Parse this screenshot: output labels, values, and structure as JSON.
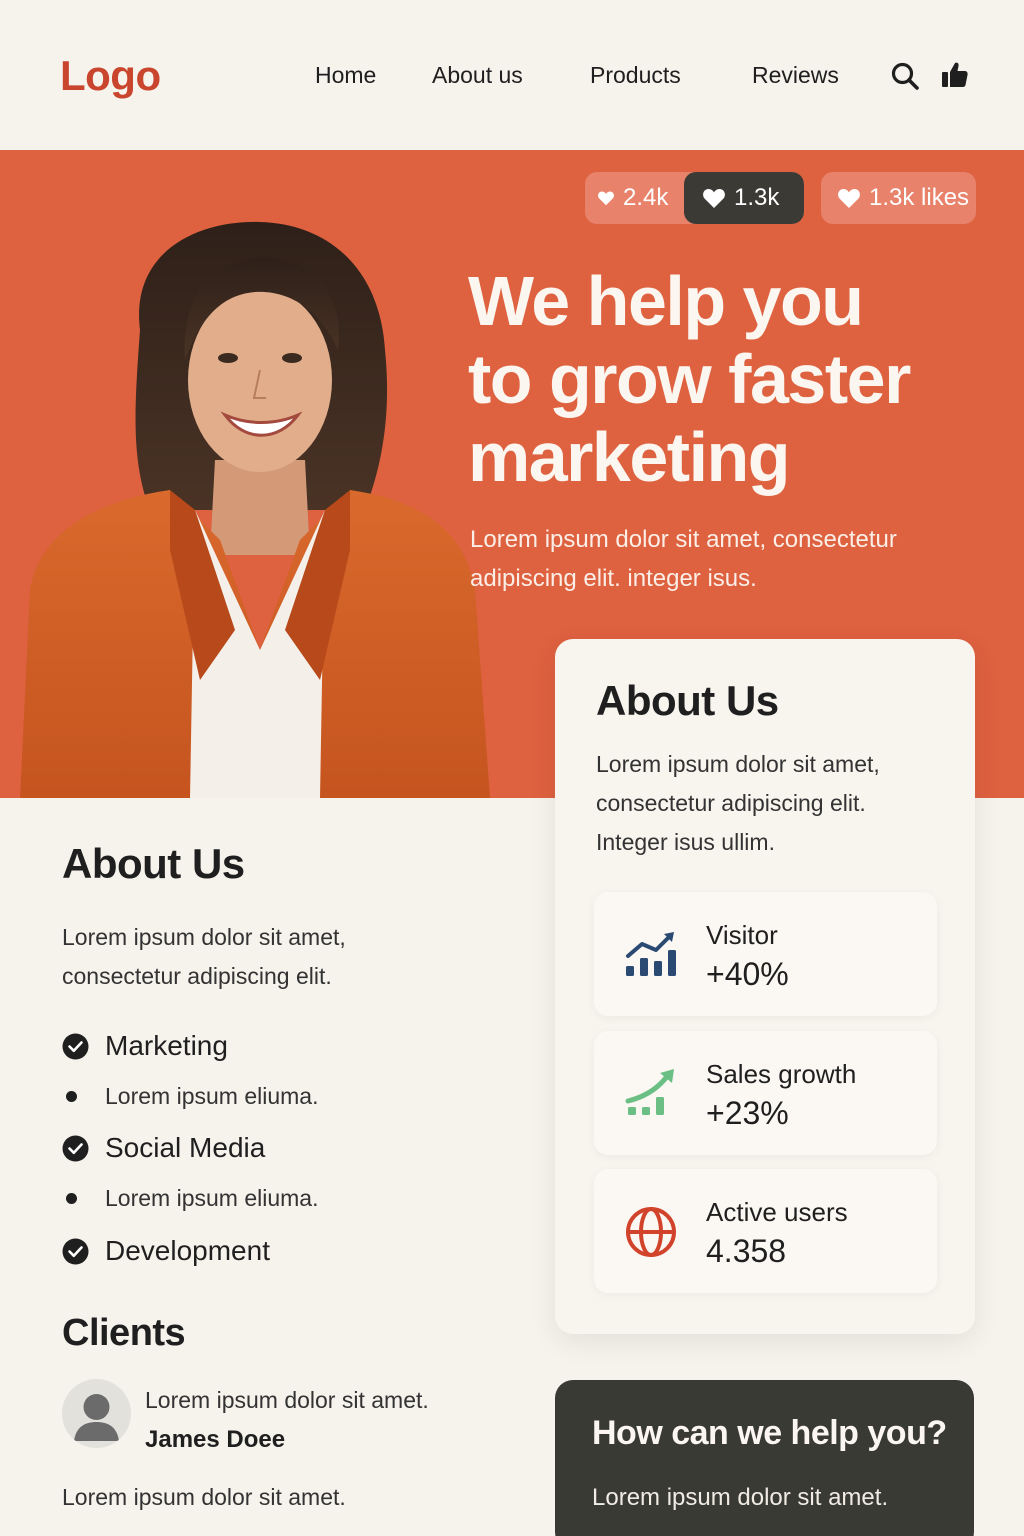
{
  "header": {
    "logo": "Logo",
    "nav": [
      "Home",
      "About us",
      "Products",
      "Reviews"
    ],
    "icons": [
      "search-icon",
      "thumbs-up-icon"
    ]
  },
  "hero": {
    "pills": {
      "first": "2.4k",
      "second": "1.3k",
      "third": "1.3k likes"
    },
    "title_lines": [
      "We help you",
      "to grow faster",
      "marketing"
    ],
    "subtitle": "Lorem ipsum dolor sit amet, consectetur adipiscing elit. integer isus."
  },
  "about_left": {
    "title": "About Us",
    "text": "Lorem ipsum dolor sit amet, consectetur adipiscing elit.",
    "items": [
      {
        "label": "Marketing",
        "detail": "Lorem ipsum eliuma."
      },
      {
        "label": "Social Media",
        "detail": "Lorem ipsum eliuma."
      },
      {
        "label": "Development"
      }
    ]
  },
  "clients": {
    "title": "Clients",
    "quote": "Lorem ipsum dolor sit amet.",
    "name": "James Doee",
    "footer_text": "Lorem ipsum dolor sit amet."
  },
  "about_card": {
    "title": "About Us",
    "text": "Lorem ipsum dolor sit amet, consectetur adipiscing elit. Integer isus ullim.",
    "stats": [
      {
        "label": "Visitor",
        "value": "+40%",
        "icon": "bar-chart-trend-icon"
      },
      {
        "label": "Sales growth",
        "value": "+23%",
        "icon": "growth-arrow-icon"
      },
      {
        "label": "Active users",
        "value": "4.358",
        "icon": "globe-icon"
      }
    ]
  },
  "help_card": {
    "title": "How can we help you?",
    "text": "Lorem ipsum dolor sit amet."
  },
  "colors": {
    "accent": "#de6140",
    "logo": "#c9452e",
    "background": "#f6f2ec",
    "dark": "#3a3a35",
    "chart_blue": "#2b4a73",
    "chart_green": "#6cbf84"
  }
}
